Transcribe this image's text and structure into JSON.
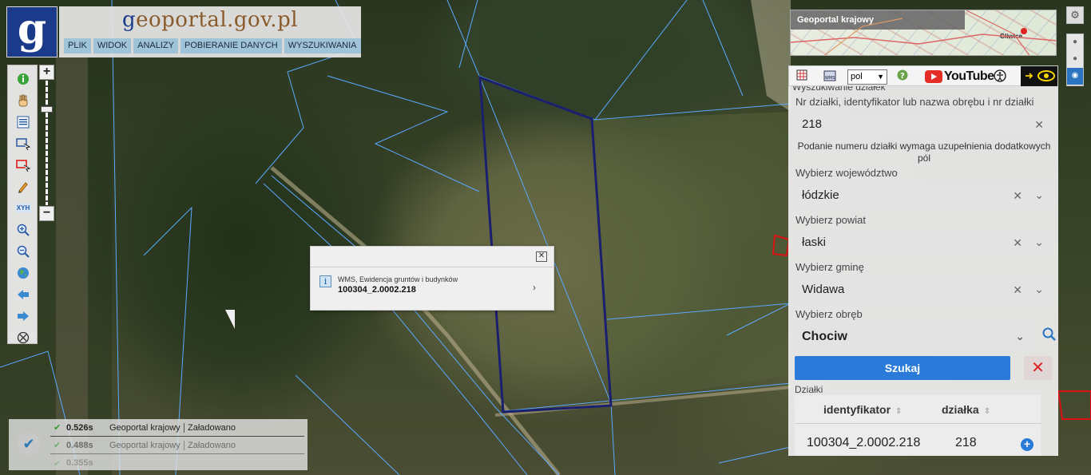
{
  "app": {
    "logo_letter": "g",
    "title_g": "g",
    "title_rest": "eoportal.gov.pl"
  },
  "menu": [
    "PLIK",
    "WIDOK",
    "ANALIZY",
    "POBIERANIE DANYCH",
    "WYSZUKIWANIA"
  ],
  "toolbar": {
    "icons": [
      "info-icon",
      "pan-hand-icon",
      "legend-icon",
      "select-area-icon",
      "select-red-icon",
      "pencil-icon",
      "xyh-icon",
      "zoom-in-icon",
      "zoom-out-icon",
      "globe-icon",
      "back-arrow-icon",
      "forward-arrow-icon",
      "clear-icon"
    ],
    "xyh_label": "XYH",
    "zoom_in": "+",
    "zoom_out": "−"
  },
  "popup": {
    "source": "WMS, Ewidencja gruntów i budynków",
    "parcel_id": "100304_2.0002.218",
    "close": "✕",
    "arrow": "›"
  },
  "status": {
    "rows": [
      {
        "time": "0.526s",
        "source": "Geoportal krajowy",
        "state": "Załadowano"
      },
      {
        "time": "0.488s",
        "source": "Geoportal krajowy",
        "state": "Załadowano"
      },
      {
        "time": "0.355s",
        "source": "",
        "state": ""
      }
    ]
  },
  "overview": {
    "title": "Geoportal krajowy",
    "city": "Gliwice"
  },
  "top_tools": {
    "lang": "pol",
    "youtube": "YouTube"
  },
  "search": {
    "section_title": "Wyszukiwanie działek",
    "parcel_label": "Nr działki, identyfikator lub nazwa obrębu i nr działki",
    "parcel_value": "218",
    "note": "Podanie numeru działki wymaga uzupełnienia dodatkowych pól",
    "voivodeship_label": "Wybierz województwo",
    "voivodeship_value": "łódzkie",
    "county_label": "Wybierz powiat",
    "county_value": "łaski",
    "commune_label": "Wybierz gminę",
    "commune_value": "Widawa",
    "precinct_label": "Wybierz obręb",
    "precinct_value": "Chociw",
    "search_button": "Szukaj",
    "results_label": "Działki",
    "col_identifier": "identyfikator",
    "col_parcel": "działka",
    "result_identifier": "100304_2.0002.218",
    "result_parcel": "218"
  },
  "colors": {
    "parcel_outline": "#1a1f6e",
    "cadastral_lines": "#5aa9ff",
    "accent": "#2a7ad9"
  }
}
